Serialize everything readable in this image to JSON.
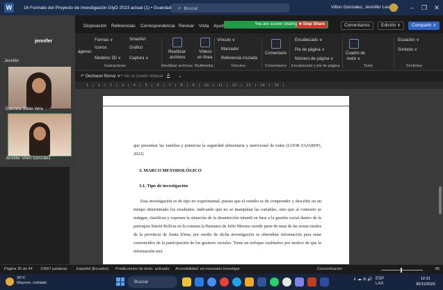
{
  "titlebar": {
    "doc_title": "16 Formato del Proyecto de investigación GlyD 2023 actual (1) • Guardado ∨",
    "search_placeholder": "Buscar",
    "user": "Villon Gonzalez, Jennifer Leonela",
    "minimize": "–",
    "restore": "❐",
    "close": "✕"
  },
  "menu": {
    "items": [
      "Disposición",
      "Referencias",
      "Correspondencia",
      "Revisar",
      "Vista",
      "Ayuda"
    ],
    "share_banner": "You are screen sharing",
    "stop_share": "■ Stop Share",
    "comments": "Comentarios",
    "edit_mode": "Edición ∨",
    "share": "Compartir ∨"
  },
  "ribbon": {
    "items": {
      "formas": "Formas ∨",
      "smartart": "SmartArt",
      "iconos": "Iconos",
      "grafico": "Gráfico",
      "modelos3d": "Modelos 3D ∨",
      "captura": "Captura ∨",
      "imagenes": "ágenes",
      "reutilizar": "Reutilizar",
      "archivos": "archivos",
      "videos": "Vídeos",
      "en_linea": "en línea",
      "vinculo": "Vínculo ∨",
      "marcador": "Marcador",
      "ref_cruzada": "Referencia cruzada",
      "comentario": "Comentario",
      "encabezado": "Encabezado ∨",
      "pie_pagina": "Pie de página ∨",
      "num_pagina": "Número de página ∨",
      "cuadro": "Cuadro de",
      "texto": "texto ∨",
      "ecuacion": "Ecuación ∨",
      "simbolo": "Símbolo ∨"
    },
    "groups": {
      "ilustraciones": "Ilustraciones",
      "reutilizar": "Reutilizar archivos",
      "multimedia": "Multimedia",
      "vinculos": "Vínculos",
      "comentarios": "Comentarios",
      "encabezado": "Encabezado y pie de página",
      "texto": "Texto",
      "simbolos": "Símbolos"
    }
  },
  "qat": {
    "undo": "↶ Deshacer Borrar ∨",
    "redo": "↷ No se puede rehacer",
    "font_color": "A",
    "more": "⌄"
  },
  "ruler": {
    "ticks": "· 1 · | · 1 · | · 2 · | · 3 · | · 4 · | · 5 · | · 6 · | · 7 · | · 8 · | · 9 · | · 10 · | · 11 · | · 12 · | · 13 · | · 14 · | · 15 · |"
  },
  "document": {
    "para1": "que presentan las familias y potenciar la seguridad alimentaria y nutricional de todos (LOOR FAJARDO, 2022).",
    "heading3": "3.    MARCO METODOLÓGICO",
    "heading31": "3.1.  Tipo de investigación",
    "para2": "Esta investigación es de tipo no experimental, puesto que el estudio es de comprender y describir en un tiempo determinado los resultados, indicando que no se manipulan las variables, sino que al contrario se indagan, clasifican y exponen la situación de la desnutrición infantil en base a la gestión social dentro de la parroquia Simón Bolívar en la comuna la Barranca de Julio Moreno siendo parte de unas de las zonas rurales de la provincia de Santa Elena, por medio de dicha investigación se obtendrán información para estar convencidos de la participación de los gestores sociales. Tiene un enfoque cualitativo por motivo de que la información será"
  },
  "video": {
    "self_name": "jennifer",
    "side_label": "Jennifer",
    "participant1": "Gabriela Suole Vera",
    "participant2": "Jennifer Villon Gonzalez"
  },
  "statusbar": {
    "page": "Página 35 de 44",
    "words": "10667 palabras",
    "language": "Español (Ecuador)",
    "predictions": "Predicciones de texto: activado",
    "accessibility": "Accesibilidad: es necesario investigar",
    "focus": "Concentración",
    "zoom": "85"
  },
  "taskbar": {
    "temp": "30°C",
    "weather": "Mayorm. nublado",
    "search": "Buscar",
    "lang": "ESP",
    "lang2": "LAA",
    "time": "12:31",
    "date": "30/11/2023",
    "tray_icons": "∧  ☁  ⊜  🔊"
  }
}
